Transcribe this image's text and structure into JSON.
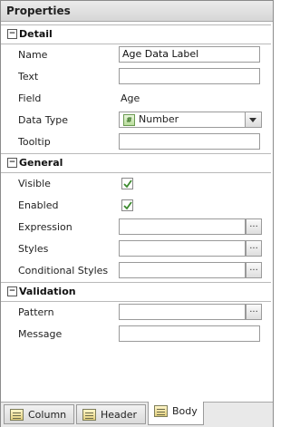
{
  "panel": {
    "title": "Properties"
  },
  "sections": {
    "detail": {
      "title": "Detail",
      "toggle": "−",
      "name": {
        "label": "Name",
        "value": "Age Data Label"
      },
      "text": {
        "label": "Text",
        "value": ""
      },
      "field": {
        "label": "Field",
        "value": "Age"
      },
      "data_type": {
        "label": "Data Type",
        "value": "Number",
        "icon": "#"
      },
      "tooltip": {
        "label": "Tooltip",
        "value": ""
      }
    },
    "general": {
      "title": "General",
      "toggle": "−",
      "visible": {
        "label": "Visible",
        "checked": true
      },
      "enabled": {
        "label": "Enabled",
        "checked": true
      },
      "expression": {
        "label": "Expression",
        "button": "..."
      },
      "styles": {
        "label": "Styles",
        "button": "..."
      },
      "conditional_styles": {
        "label": "Conditional Styles",
        "button": "..."
      }
    },
    "validation": {
      "title": "Validation",
      "toggle": "−",
      "pattern": {
        "label": "Pattern",
        "button": "..."
      },
      "message": {
        "label": "Message",
        "value": ""
      }
    }
  },
  "tabs": [
    {
      "label": "Column",
      "active": false
    },
    {
      "label": "Header",
      "active": false
    },
    {
      "label": "Body",
      "active": true
    }
  ],
  "colors": {
    "check": "#3c8a2e",
    "panel_border": "#8c8c8c"
  }
}
